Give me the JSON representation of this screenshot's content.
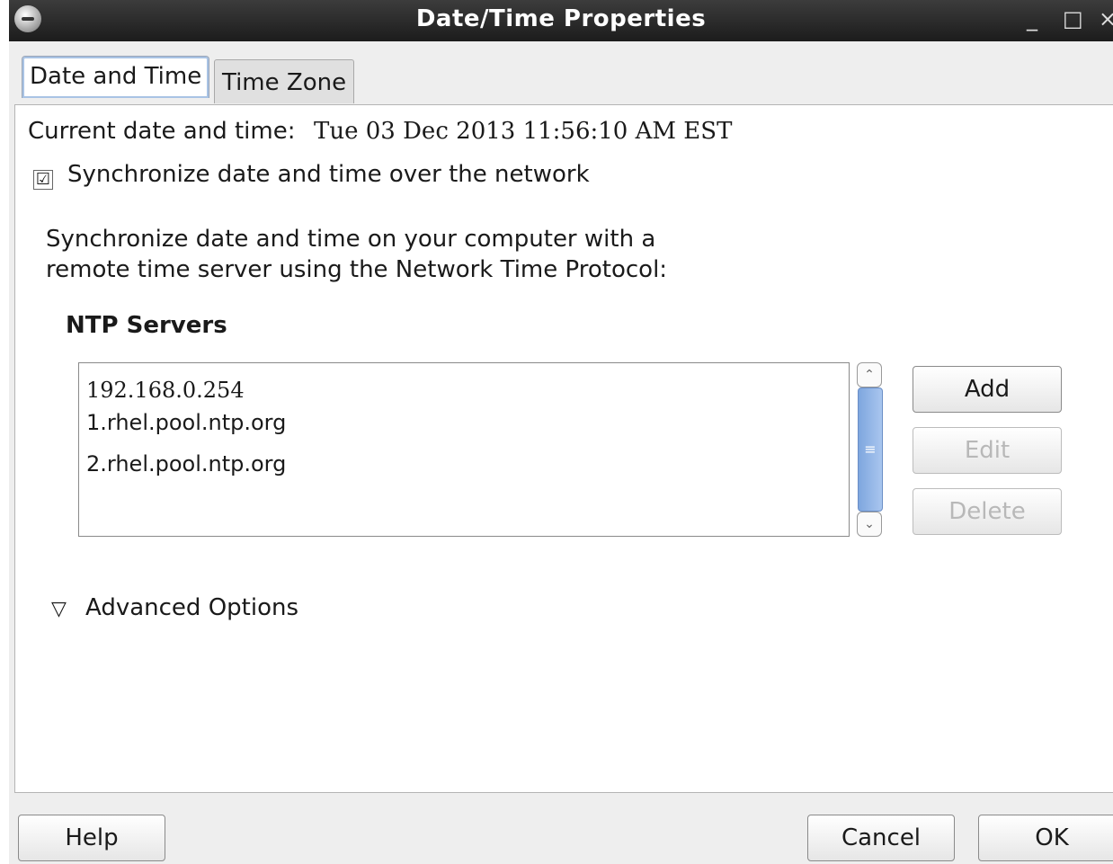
{
  "window": {
    "title": "Date/Time Properties",
    "minimize": "_",
    "maximize": "□",
    "close": "×"
  },
  "tabs": [
    {
      "label": "Date and Time"
    },
    {
      "label": "Time Zone"
    }
  ],
  "current": {
    "label": "Current date and time:",
    "value": "Tue 03 Dec 2013 11:56:10 AM EST"
  },
  "sync": {
    "checked_glyph": "☑",
    "label": "Synchronize date and time over the network"
  },
  "description": {
    "line1": "Synchronize date and time on your computer with a",
    "line2": "remote time server using the Network Time Protocol:"
  },
  "ntp": {
    "heading": "NTP Servers",
    "servers": [
      "192.168.0.254",
      "1.rhel.pool.ntp.org",
      "2.rhel.pool.ntp.org"
    ],
    "scroll_up": "⌃",
    "scroll_thumb": "≡",
    "scroll_down": "⌄",
    "buttons": {
      "add": "Add",
      "edit": "Edit",
      "delete": "Delete"
    }
  },
  "advanced": {
    "icon": "▽",
    "label": "Advanced Options"
  },
  "footer": {
    "help": "Help",
    "cancel": "Cancel",
    "ok": "OK"
  }
}
